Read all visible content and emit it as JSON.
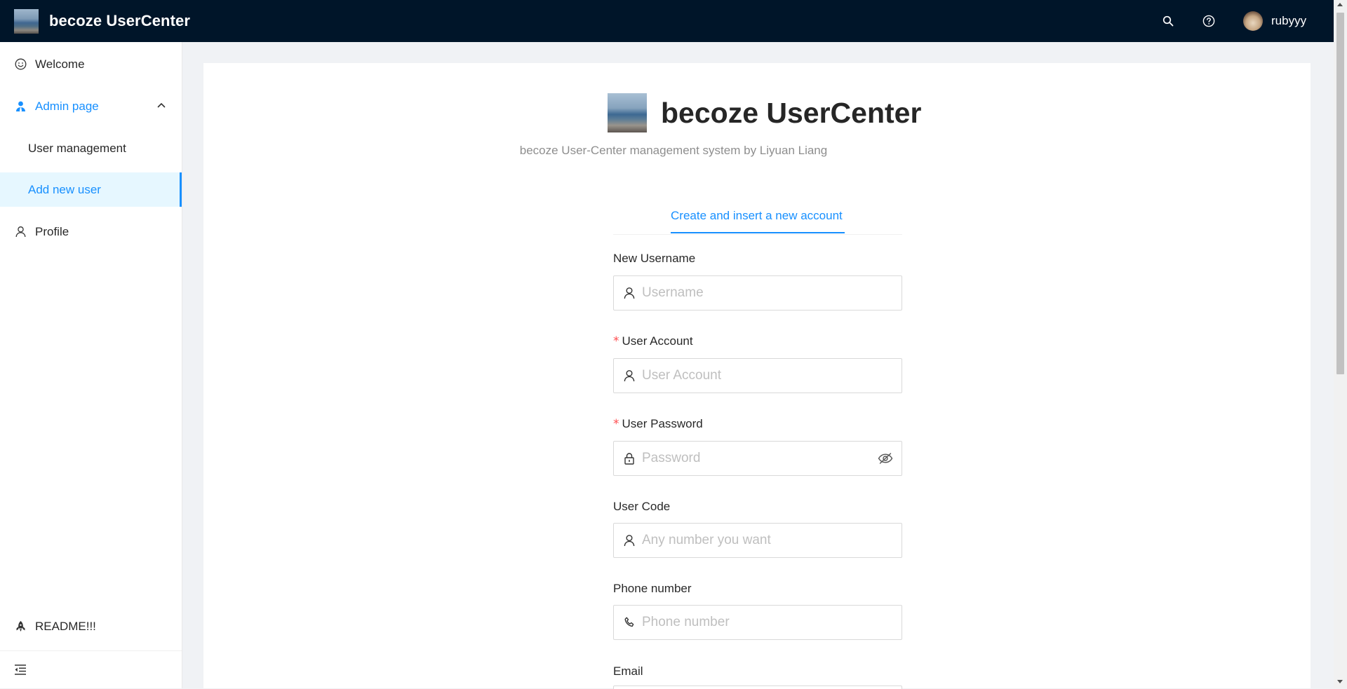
{
  "header": {
    "brand": "becoze UserCenter",
    "username": "rubyyy",
    "icons": [
      "search-icon",
      "question-icon"
    ]
  },
  "sidebar": {
    "items": [
      {
        "label": "Welcome",
        "icon": "smile-icon"
      },
      {
        "label": "Admin page",
        "icon": "crown-user-icon",
        "state": "open"
      },
      {
        "label": "User management"
      },
      {
        "label": "Add new user",
        "state": "selected"
      },
      {
        "label": "Profile",
        "icon": "user-icon"
      },
      {
        "label": "README!!!",
        "icon": "rocket-icon"
      }
    ],
    "collapse_icon": "menu-fold-icon"
  },
  "page": {
    "title": "becoze UserCenter",
    "subtitle": "becoze User-Center management system by Liyuan Liang",
    "tab": "Create and insert a new account"
  },
  "form": {
    "fields": [
      {
        "label": "New Username",
        "required": false,
        "placeholder": "Username",
        "icon": "user-icon"
      },
      {
        "label": "User Account",
        "required": true,
        "placeholder": "User Account",
        "icon": "user-icon"
      },
      {
        "label": "User Password",
        "required": true,
        "placeholder": "Password",
        "icon": "lock-icon"
      },
      {
        "label": "User Code",
        "required": false,
        "placeholder": "Any number you want",
        "icon": "user-icon"
      },
      {
        "label": "Phone number",
        "required": false,
        "placeholder": "Phone number",
        "icon": "phone-icon"
      },
      {
        "label": "Email",
        "required": false
      }
    ],
    "required_mark": "*"
  },
  "colors": {
    "header_bg": "#001529",
    "accent": "#1890ff",
    "required": "#ff4d4f",
    "page_bg": "#f0f2f5"
  }
}
